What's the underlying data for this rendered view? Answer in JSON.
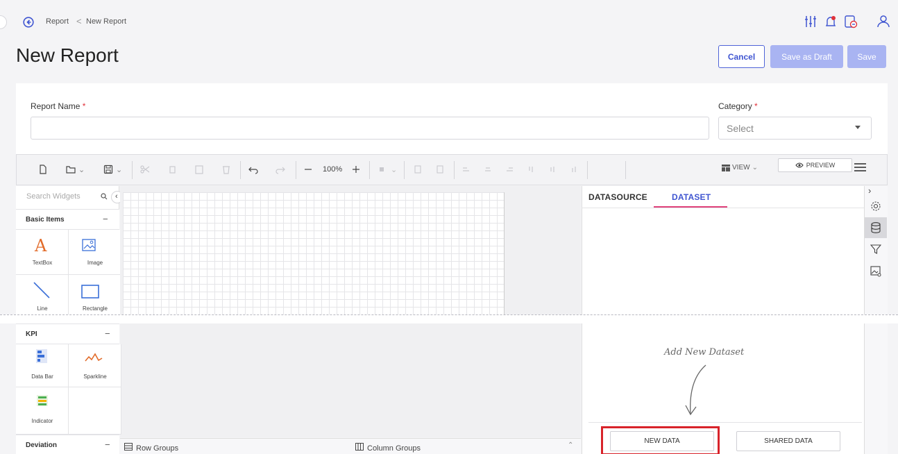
{
  "header": {
    "breadcrumb": {
      "root": "Report",
      "separator": "<",
      "current": "New Report"
    },
    "title": "New Report",
    "buttons": {
      "cancel": "Cancel",
      "draft": "Save as Draft",
      "save": "Save"
    },
    "icons": [
      "equalizer-icon",
      "notification-bell-icon",
      "report-status-icon",
      "user-icon"
    ]
  },
  "form": {
    "report_name_label": "Report Name",
    "category_label": "Category",
    "required_mark": "*",
    "category_placeholder": "Select"
  },
  "toolbar": {
    "zoom": "100%",
    "view_label": "VIEW",
    "preview_label": "PREVIEW"
  },
  "widgets": {
    "search_placeholder": "Search Widgets",
    "groups": [
      {
        "title": "Basic Items",
        "items": [
          "TextBox",
          "Image",
          "Line",
          "Rectangle"
        ]
      },
      {
        "title": "KPI",
        "items": [
          "Data Bar",
          "Sparkline",
          "Indicator"
        ]
      },
      {
        "title": "Deviation",
        "items": []
      }
    ]
  },
  "canvas": {
    "row_groups": "Row Groups",
    "column_groups": "Column Groups"
  },
  "data_panel": {
    "tabs": [
      "DATASOURCE",
      "DATASET"
    ],
    "active_tab": "DATASET",
    "hint": "Add New Dataset",
    "new_data": "NEW DATA",
    "shared_data": "SHARED DATA"
  },
  "colors": {
    "accent": "#3f55d1",
    "disabled": "#a9b4f2",
    "tab_active": "#e0417a",
    "highlight": "#d8232a",
    "required": "#e0313a"
  }
}
